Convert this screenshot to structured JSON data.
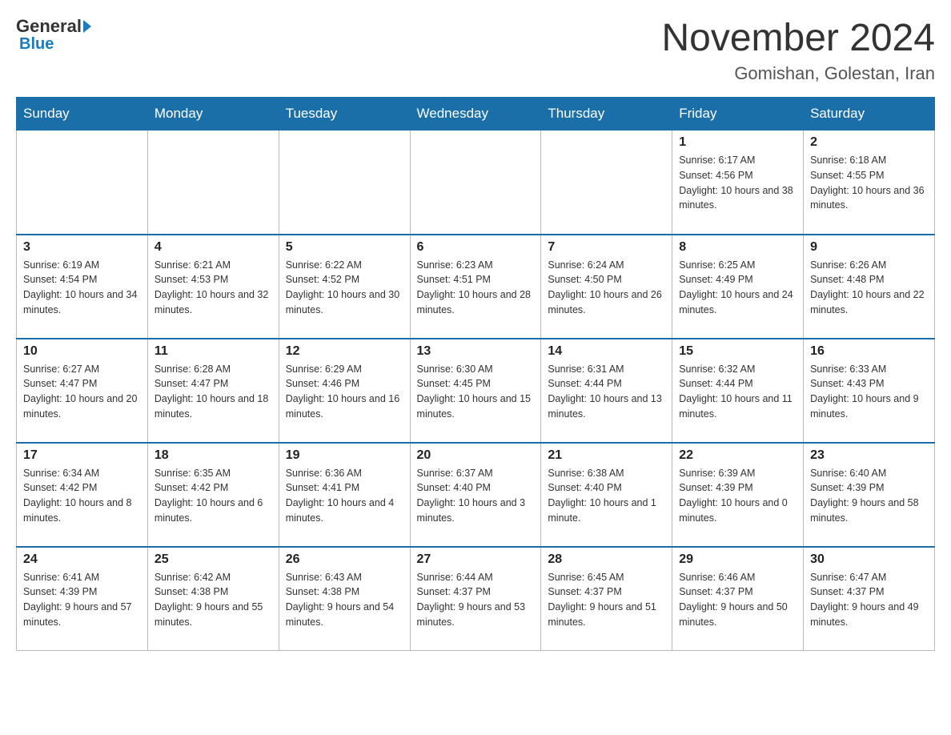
{
  "header": {
    "logo_general": "General",
    "logo_blue": "Blue",
    "month_title": "November 2024",
    "location": "Gomishan, Golestan, Iran"
  },
  "days_of_week": [
    "Sunday",
    "Monday",
    "Tuesday",
    "Wednesday",
    "Thursday",
    "Friday",
    "Saturday"
  ],
  "weeks": [
    [
      {
        "day": "",
        "info": ""
      },
      {
        "day": "",
        "info": ""
      },
      {
        "day": "",
        "info": ""
      },
      {
        "day": "",
        "info": ""
      },
      {
        "day": "",
        "info": ""
      },
      {
        "day": "1",
        "info": "Sunrise: 6:17 AM\nSunset: 4:56 PM\nDaylight: 10 hours and 38 minutes."
      },
      {
        "day": "2",
        "info": "Sunrise: 6:18 AM\nSunset: 4:55 PM\nDaylight: 10 hours and 36 minutes."
      }
    ],
    [
      {
        "day": "3",
        "info": "Sunrise: 6:19 AM\nSunset: 4:54 PM\nDaylight: 10 hours and 34 minutes."
      },
      {
        "day": "4",
        "info": "Sunrise: 6:21 AM\nSunset: 4:53 PM\nDaylight: 10 hours and 32 minutes."
      },
      {
        "day": "5",
        "info": "Sunrise: 6:22 AM\nSunset: 4:52 PM\nDaylight: 10 hours and 30 minutes."
      },
      {
        "day": "6",
        "info": "Sunrise: 6:23 AM\nSunset: 4:51 PM\nDaylight: 10 hours and 28 minutes."
      },
      {
        "day": "7",
        "info": "Sunrise: 6:24 AM\nSunset: 4:50 PM\nDaylight: 10 hours and 26 minutes."
      },
      {
        "day": "8",
        "info": "Sunrise: 6:25 AM\nSunset: 4:49 PM\nDaylight: 10 hours and 24 minutes."
      },
      {
        "day": "9",
        "info": "Sunrise: 6:26 AM\nSunset: 4:48 PM\nDaylight: 10 hours and 22 minutes."
      }
    ],
    [
      {
        "day": "10",
        "info": "Sunrise: 6:27 AM\nSunset: 4:47 PM\nDaylight: 10 hours and 20 minutes."
      },
      {
        "day": "11",
        "info": "Sunrise: 6:28 AM\nSunset: 4:47 PM\nDaylight: 10 hours and 18 minutes."
      },
      {
        "day": "12",
        "info": "Sunrise: 6:29 AM\nSunset: 4:46 PM\nDaylight: 10 hours and 16 minutes."
      },
      {
        "day": "13",
        "info": "Sunrise: 6:30 AM\nSunset: 4:45 PM\nDaylight: 10 hours and 15 minutes."
      },
      {
        "day": "14",
        "info": "Sunrise: 6:31 AM\nSunset: 4:44 PM\nDaylight: 10 hours and 13 minutes."
      },
      {
        "day": "15",
        "info": "Sunrise: 6:32 AM\nSunset: 4:44 PM\nDaylight: 10 hours and 11 minutes."
      },
      {
        "day": "16",
        "info": "Sunrise: 6:33 AM\nSunset: 4:43 PM\nDaylight: 10 hours and 9 minutes."
      }
    ],
    [
      {
        "day": "17",
        "info": "Sunrise: 6:34 AM\nSunset: 4:42 PM\nDaylight: 10 hours and 8 minutes."
      },
      {
        "day": "18",
        "info": "Sunrise: 6:35 AM\nSunset: 4:42 PM\nDaylight: 10 hours and 6 minutes."
      },
      {
        "day": "19",
        "info": "Sunrise: 6:36 AM\nSunset: 4:41 PM\nDaylight: 10 hours and 4 minutes."
      },
      {
        "day": "20",
        "info": "Sunrise: 6:37 AM\nSunset: 4:40 PM\nDaylight: 10 hours and 3 minutes."
      },
      {
        "day": "21",
        "info": "Sunrise: 6:38 AM\nSunset: 4:40 PM\nDaylight: 10 hours and 1 minute."
      },
      {
        "day": "22",
        "info": "Sunrise: 6:39 AM\nSunset: 4:39 PM\nDaylight: 10 hours and 0 minutes."
      },
      {
        "day": "23",
        "info": "Sunrise: 6:40 AM\nSunset: 4:39 PM\nDaylight: 9 hours and 58 minutes."
      }
    ],
    [
      {
        "day": "24",
        "info": "Sunrise: 6:41 AM\nSunset: 4:39 PM\nDaylight: 9 hours and 57 minutes."
      },
      {
        "day": "25",
        "info": "Sunrise: 6:42 AM\nSunset: 4:38 PM\nDaylight: 9 hours and 55 minutes."
      },
      {
        "day": "26",
        "info": "Sunrise: 6:43 AM\nSunset: 4:38 PM\nDaylight: 9 hours and 54 minutes."
      },
      {
        "day": "27",
        "info": "Sunrise: 6:44 AM\nSunset: 4:37 PM\nDaylight: 9 hours and 53 minutes."
      },
      {
        "day": "28",
        "info": "Sunrise: 6:45 AM\nSunset: 4:37 PM\nDaylight: 9 hours and 51 minutes."
      },
      {
        "day": "29",
        "info": "Sunrise: 6:46 AM\nSunset: 4:37 PM\nDaylight: 9 hours and 50 minutes."
      },
      {
        "day": "30",
        "info": "Sunrise: 6:47 AM\nSunset: 4:37 PM\nDaylight: 9 hours and 49 minutes."
      }
    ]
  ]
}
